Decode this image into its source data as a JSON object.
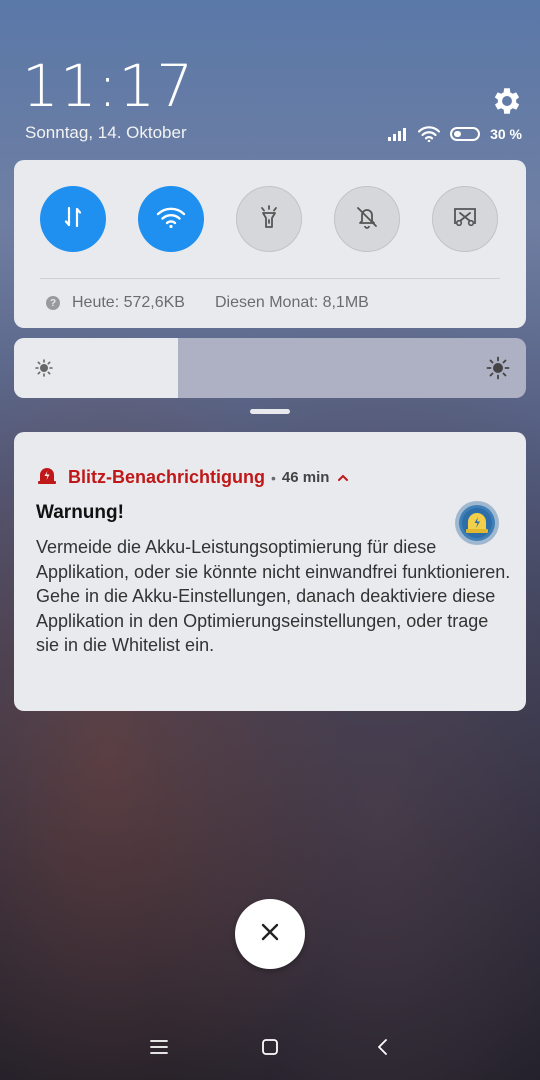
{
  "statusbar": {
    "time": "11:17",
    "date": "Sonntag, 14. Oktober",
    "battery_percent": "30 %",
    "battery_level": 0.3,
    "icons": [
      "signal-icon",
      "wifi-icon",
      "battery-icon"
    ]
  },
  "header": {
    "settings_icon": "gear-icon"
  },
  "quick_settings": {
    "toggles": [
      {
        "name": "mobile-data",
        "icon": "data-arrows-icon",
        "state": "on"
      },
      {
        "name": "wifi",
        "icon": "wifi-icon",
        "state": "on"
      },
      {
        "name": "flashlight",
        "icon": "flashlight-icon",
        "state": "off"
      },
      {
        "name": "silent",
        "icon": "bell-off-icon",
        "state": "off"
      },
      {
        "name": "screenshot",
        "icon": "screenshot-scissors-icon",
        "state": "off"
      }
    ],
    "usage_today": "Heute: 572,6KB",
    "usage_month": "Diesen Monat: 8,1MB"
  },
  "brightness": {
    "level": 0.32
  },
  "notification": {
    "app_name": "Blitz-Benachrichtigung",
    "separator": "•",
    "age": "46 min",
    "title": "Warnung!",
    "body": "Vermeide die Akku-Leistungsoptimierung für diese Applikation, oder sie könnte nicht einwandfrei funktionieren. Gehe in die Akku-Einstellungen, danach deaktiviere diese Applikation in den Optimierungseinstellungen, oder trage sie in die Whitelist ein.",
    "accent_color": "#c01818"
  },
  "colors": {
    "toggle_on": "#1f8ff0",
    "panel": "#e9eaee"
  },
  "navbar": [
    "menu-icon",
    "home-icon",
    "back-icon"
  ]
}
